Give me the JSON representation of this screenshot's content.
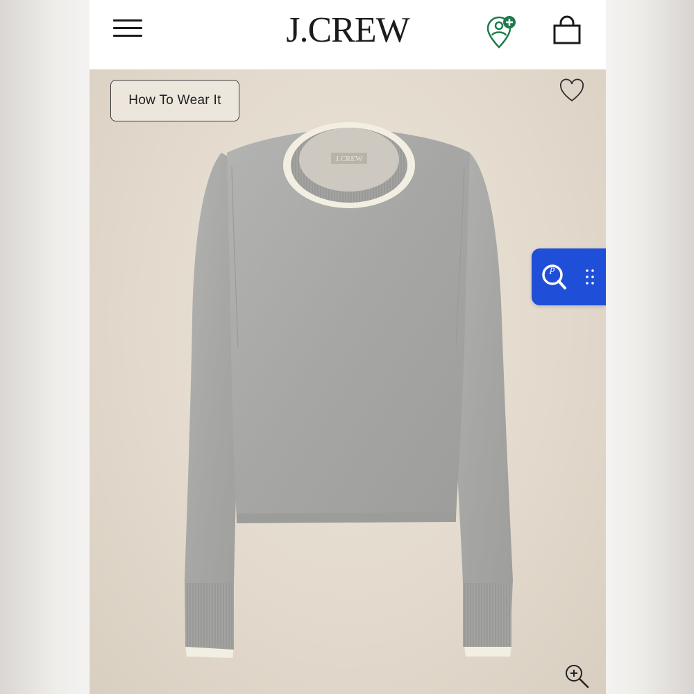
{
  "header": {
    "logo_text": "J.CREW",
    "menu_icon": "hamburger-menu-icon",
    "rewards_icon": "rewards-location-plus-icon",
    "bag_icon": "shopping-bag-icon"
  },
  "product_image": {
    "how_to_wear_label": "How To Wear It",
    "favorite_icon": "heart-icon",
    "visual_search_icon": "visual-search-icon",
    "drag_handle_icon": "drag-handle-dots-icon",
    "zoom_icon": "zoom-in-icon",
    "neck_label_text": "J.CREW"
  },
  "colors": {
    "header_bg": "#ffffff",
    "image_bg": "#e5dccf",
    "sweater": "#a9a9a7",
    "trim": "#f3eee2",
    "accent_blue": "#1f4fd8",
    "rewards_green": "#1e7a4c"
  }
}
